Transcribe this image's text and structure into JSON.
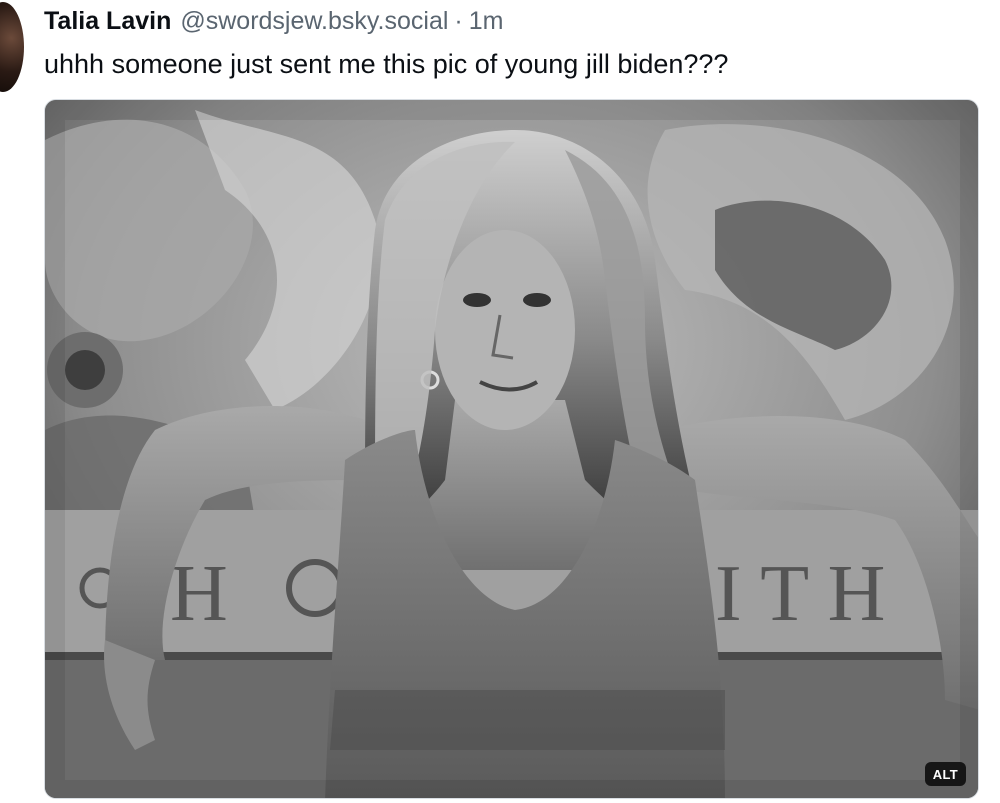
{
  "post": {
    "author": {
      "display_name": "Talia Lavin",
      "handle": "@swordsjew.bsky.social",
      "separator": "·",
      "timestamp": "1m"
    },
    "text": "uhhh someone just sent me this pic of young jill biden???",
    "media": {
      "type": "image",
      "style": "black-and-white photograph",
      "alt_badge": "ALT"
    }
  }
}
